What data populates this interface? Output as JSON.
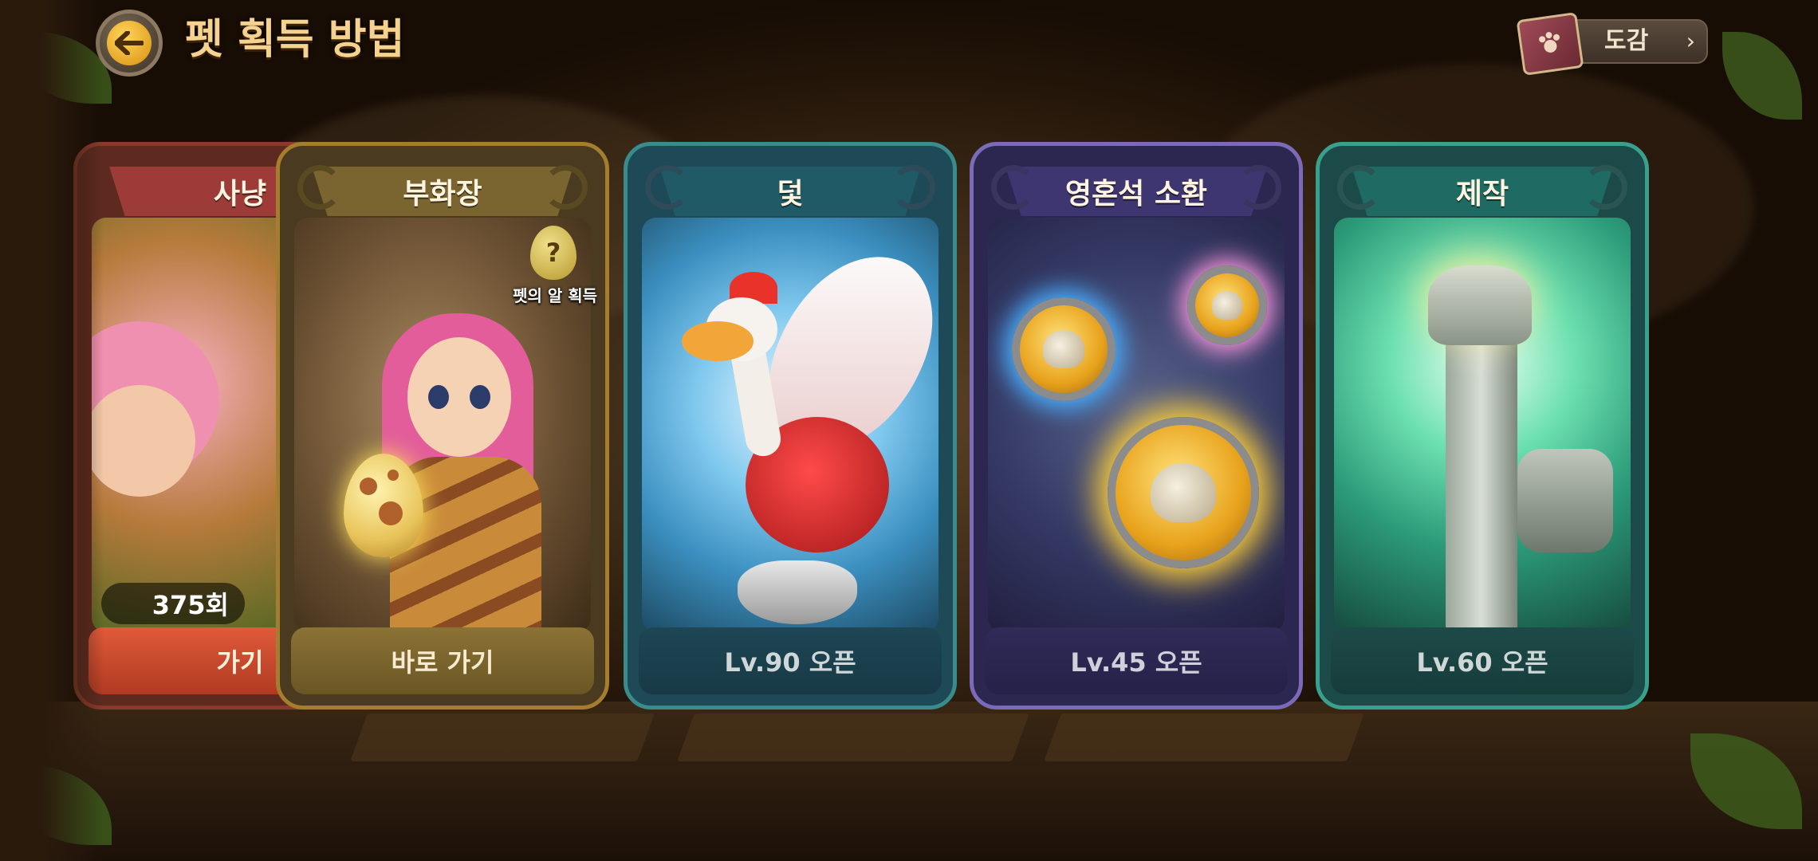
{
  "header": {
    "title": "펫 획득 방법",
    "back_icon": "back-arrow-icon",
    "dogam_label": "도감",
    "dogam_icon": "book-icon",
    "dogam_chevron": "›"
  },
  "cards": [
    {
      "id": "hunt",
      "title": "사냥",
      "count": "375회",
      "action": "가기",
      "theme": "#9c3b37"
    },
    {
      "id": "hatchery",
      "title": "부화장",
      "badge_label": "펫의 알 획득",
      "badge_icon": "?",
      "action": "바로 가기",
      "theme": "#7a6530"
    },
    {
      "id": "trap",
      "title": "덫",
      "action": "Lv.90 오픈",
      "theme": "#1f5a66"
    },
    {
      "id": "soulstone",
      "title": "영혼석 소환",
      "action": "Lv.45 오픈",
      "theme": "#3d3670"
    },
    {
      "id": "craft",
      "title": "제작",
      "action": "Lv.60 오픈",
      "theme": "#1f6a62"
    }
  ]
}
